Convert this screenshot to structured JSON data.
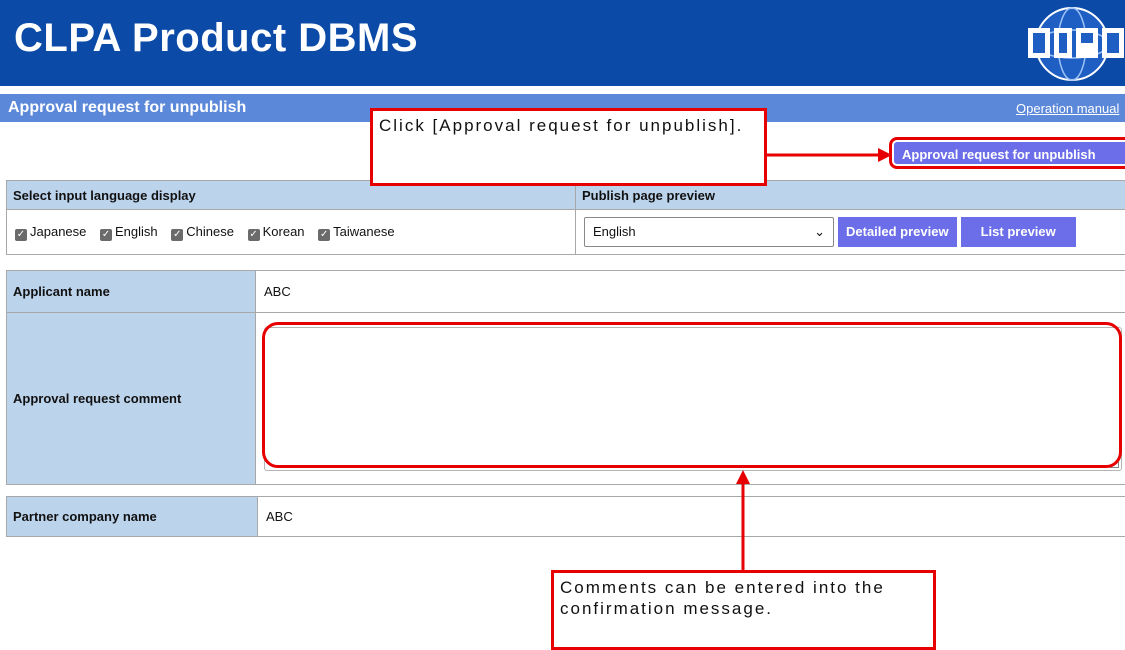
{
  "header": {
    "app_title": "CLPA Product DBMS"
  },
  "subbar": {
    "page_title": "Approval request for unpublish",
    "manual_link": "Operation manual"
  },
  "actions": {
    "unpublish_button": "Approval request for unpublish"
  },
  "language": {
    "select_label": "Select input language display",
    "preview_label": "Publish page preview",
    "options": [
      "Japanese",
      "English",
      "Chinese",
      "Korean",
      "Taiwanese"
    ],
    "preview_selected": "English",
    "detailed_preview": "Detailed preview",
    "list_preview": "List preview"
  },
  "form": {
    "applicant_label": "Applicant name",
    "applicant_value": "ABC",
    "comment_label": "Approval request comment",
    "comment_value": "",
    "partner_label": "Partner company name",
    "partner_value": "ABC"
  },
  "annotations": {
    "callout_click": "Click [Approval request for unpublish].",
    "callout_comment": "Comments can be entered into the confirmation message."
  },
  "colors": {
    "header_bg": "#0c4aa8",
    "subbar_bg": "#5b88d8",
    "accent": "#6b6ee8",
    "annotation": "#e60000"
  },
  "icons": [
    "clpa-logo",
    "checkbox-checked-icon",
    "chevron-down-icon"
  ]
}
